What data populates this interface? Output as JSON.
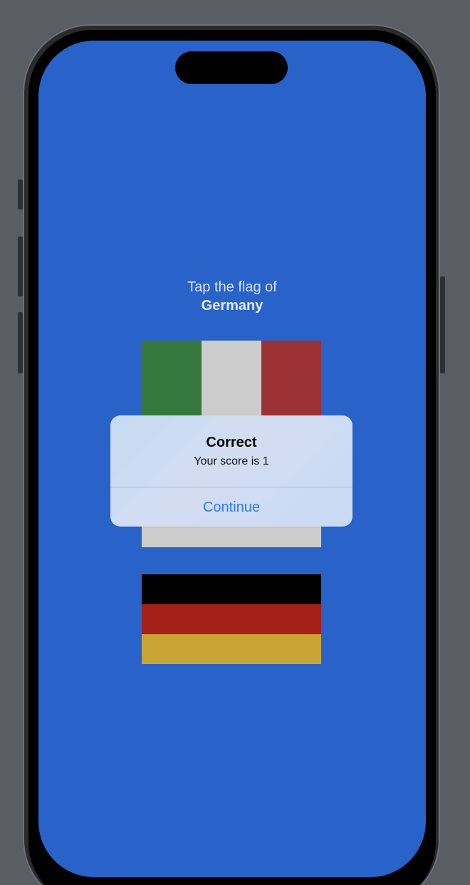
{
  "prompt": {
    "line1": "Tap the flag of",
    "country": "Germany"
  },
  "flags": [
    {
      "country": "Italy",
      "bands": [
        "#35783e",
        "#cccccc",
        "#9a3233"
      ]
    },
    {
      "country": "Germany",
      "bands": [
        "#000000",
        "#a52019",
        "#c9a536"
      ]
    }
  ],
  "alert": {
    "title": "Correct",
    "message": "Your score is 1",
    "button_label": "Continue"
  },
  "colors": {
    "background": "#2962c8",
    "alert_button": "#2f7ef0"
  }
}
